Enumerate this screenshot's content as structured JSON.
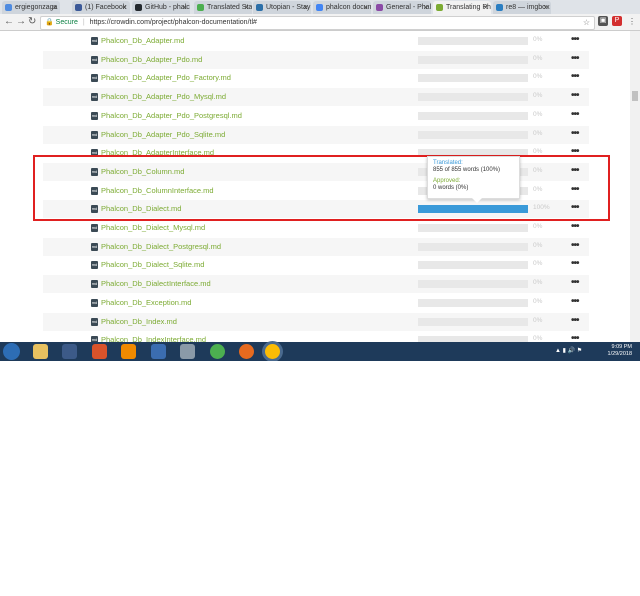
{
  "browser": {
    "tabs": [
      {
        "label": "ergiegonzaga",
        "icon_color": "#4e8be0",
        "active": false
      },
      {
        "label": "(1) Facebook",
        "icon_color": "#3b5998",
        "active": false
      },
      {
        "label": "GitHub - phalcon",
        "icon_color": "#24292e",
        "active": false
      },
      {
        "label": "Translated Stat",
        "icon_color": "#4caf50",
        "active": false
      },
      {
        "label": "Utopian - Stay in",
        "icon_color": "#2c6fa8",
        "active": false
      },
      {
        "label": "phalcon docum",
        "icon_color": "#4285f4",
        "active": false
      },
      {
        "label": "General - Phalc",
        "icon_color": "#8b4aa6",
        "active": false
      },
      {
        "label": "Translating Ph",
        "icon_color": "#7cab33",
        "active": true
      },
      {
        "label": "re8 — imgbox",
        "icon_color": "#2a7ec2",
        "active": false
      }
    ],
    "close_glyph": "×",
    "back_icon": "arrow-left-icon",
    "forward_icon": "arrow-right-icon",
    "reload_icon": "reload-icon",
    "secure_label": "Secure",
    "url": "https://crowdin.com/project/phalcon-documentation/tl#"
  },
  "files": [
    {
      "name": "Phalcon_Db_Adapter.md",
      "pct": "0%",
      "progress": 0
    },
    {
      "name": "Phalcon_Db_Adapter_Pdo.md",
      "pct": "0%",
      "progress": 0
    },
    {
      "name": "Phalcon_Db_Adapter_Pdo_Factory.md",
      "pct": "0%",
      "progress": 0
    },
    {
      "name": "Phalcon_Db_Adapter_Pdo_Mysql.md",
      "pct": "0%",
      "progress": 0
    },
    {
      "name": "Phalcon_Db_Adapter_Pdo_Postgresql.md",
      "pct": "0%",
      "progress": 0
    },
    {
      "name": "Phalcon_Db_Adapter_Pdo_Sqlite.md",
      "pct": "0%",
      "progress": 0
    },
    {
      "name": "Phalcon_Db_AdapterInterface.md",
      "pct": "0%",
      "progress": 0
    },
    {
      "name": "Phalcon_Db_Column.md",
      "pct": "0%",
      "progress": 0
    },
    {
      "name": "Phalcon_Db_ColumnInterface.md",
      "pct": "0%",
      "progress": 0
    },
    {
      "name": "Phalcon_Db_Dialect.md",
      "pct": "100%",
      "progress": 1
    },
    {
      "name": "Phalcon_Db_Dialect_Mysql.md",
      "pct": "0%",
      "progress": 0
    },
    {
      "name": "Phalcon_Db_Dialect_Postgresql.md",
      "pct": "0%",
      "progress": 0
    },
    {
      "name": "Phalcon_Db_Dialect_Sqlite.md",
      "pct": "0%",
      "progress": 0
    },
    {
      "name": "Phalcon_Db_DialectInterface.md",
      "pct": "0%",
      "progress": 0
    },
    {
      "name": "Phalcon_Db_Exception.md",
      "pct": "0%",
      "progress": 0
    },
    {
      "name": "Phalcon_Db_Index.md",
      "pct": "0%",
      "progress": 0
    },
    {
      "name": "Phalcon_Db_IndexInterface.md",
      "pct": "0%",
      "progress": 0
    }
  ],
  "menu_glyph": "•••",
  "tooltip": {
    "translated_label": "Translated:",
    "translated_value": "855 of 855 words (100%)",
    "approved_label": "Approved:",
    "approved_value": "0 words (0%)"
  },
  "taskbar": {
    "time": "9:09 PM",
    "date": "1/29/2018"
  },
  "colors": {
    "highlight": "#e02020",
    "progress": "#3a9ad9",
    "filename": "#7cab33"
  }
}
